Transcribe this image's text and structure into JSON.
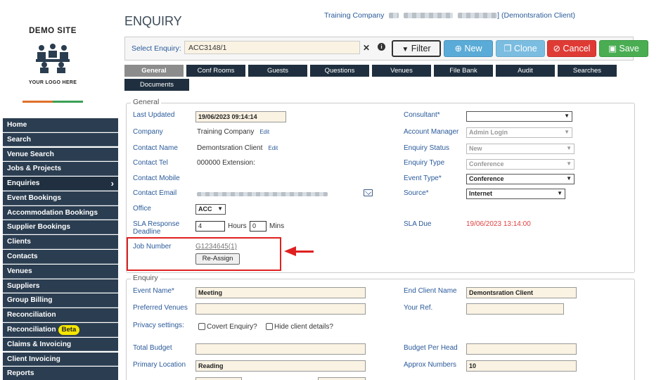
{
  "brand": {
    "site_name": "DEMO SITE",
    "logo_caption": "YOUR LOGO HERE"
  },
  "page": {
    "title": "ENQUIRY",
    "company_prefix": "Training Company",
    "company_suffix": "] (Demontsration Client)"
  },
  "sidebar": {
    "items": [
      {
        "label": "Home"
      },
      {
        "label": "Search"
      },
      {
        "label": "Venue Search"
      },
      {
        "label": "Jobs & Projects"
      },
      {
        "label": "Enquiries"
      },
      {
        "label": "Event Bookings"
      },
      {
        "label": "Accommodation Bookings"
      },
      {
        "label": "Supplier Bookings"
      },
      {
        "label": "Clients"
      },
      {
        "label": "Contacts"
      },
      {
        "label": "Venues"
      },
      {
        "label": "Suppliers"
      },
      {
        "label": "Group Billing"
      },
      {
        "label": "Reconciliation"
      },
      {
        "label": "Reconciliation",
        "badge": "Beta"
      },
      {
        "label": "Claims & Invoicing"
      },
      {
        "label": "Client Invoicing"
      },
      {
        "label": "Reports"
      }
    ],
    "chevron": "›"
  },
  "enquiry_bar": {
    "label": "Select Enquiry:",
    "value": "ACC3148/1",
    "clear_icon": "✕",
    "info_icon": "i",
    "buttons": {
      "filter": "Filter",
      "new": "New",
      "clone": "Clone",
      "cancel": "Cancel",
      "save": "Save"
    }
  },
  "tabs": [
    "General",
    "Conf Rooms",
    "Guests",
    "Questions",
    "Venues",
    "File Bank",
    "Audit",
    "Searches",
    "Documents"
  ],
  "general": {
    "legend": "General",
    "last_updated_label": "Last Updated",
    "last_updated": "19/06/2023 09:14:14",
    "company_label": "Company",
    "company": "Training Company",
    "edit": "Edit",
    "contact_name_label": "Contact Name",
    "contact_name": "Demontsration Client",
    "contact_tel_label": "Contact Tel",
    "contact_tel": "000000 Extension:",
    "contact_mobile_label": "Contact Mobile",
    "contact_email_label": "Contact Email",
    "office_label": "Office",
    "office": "ACC",
    "sla_label_1": "SLA Response",
    "sla_label_2": "Deadline",
    "sla_hours": "4",
    "hours_label": "Hours",
    "sla_mins": "0",
    "mins_label": "Mins",
    "job_number_label": "Job Number",
    "job_number": "G1234645(1)",
    "reassign": "Re-Assign",
    "consultant_label": "Consultant*",
    "consultant": "",
    "account_manager_label": "Account Manager",
    "account_manager": "Admin Login",
    "enquiry_status_label": "Enquiry Status",
    "enquiry_status": "New",
    "enquiry_type_label": "Enquiry Type",
    "enquiry_type": "Conference",
    "event_type_label": "Event Type*",
    "event_type": "Conference",
    "source_label": "Source*",
    "source": "Internet",
    "sla_due_label": "SLA Due",
    "sla_due": "19/06/2023 13:14:00"
  },
  "enquiry": {
    "legend": "Enquiry",
    "event_name_label": "Event Name*",
    "event_name": "Meeting",
    "preferred_venues_label": "Preferred Venues",
    "privacy_label": "Privacy settings:",
    "covert_label": "Covert Enquiry?",
    "hide_label": "Hide client details?",
    "total_budget_label": "Total Budget",
    "primary_location_label": "Primary Location",
    "primary_location": "Reading",
    "end_client_label": "End Client Name",
    "end_client": "Demontsration Client",
    "your_ref_label": "Your Ref.",
    "budget_per_head_label": "Budget Per Head",
    "approx_numbers_label": "Approx Numbers",
    "approx_numbers": "10"
  },
  "colors": {
    "sidebar_bg": "#2b3d50",
    "tab_bg": "#1f2f3f",
    "accent_blue": "#2a5a9a",
    "highlight_red": "#e02020"
  }
}
